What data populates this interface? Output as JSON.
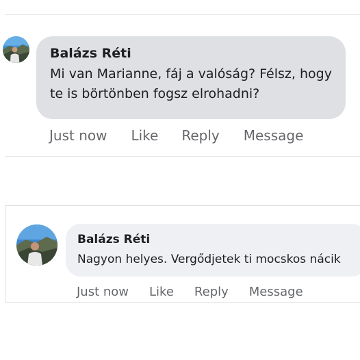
{
  "comments": [
    {
      "author": "Balázs Réti",
      "text": "Mi van Marianne, fáj a valóság? Félsz, hogy te is börtönben fogsz elrohadni?",
      "actions": {
        "time": "Just now",
        "like": "Like",
        "reply": "Reply",
        "message": "Message"
      }
    },
    {
      "author": "Balázs Réti",
      "text": "Nagyon helyes. Vergődjetek ti mocskos nácik",
      "actions": {
        "time": "Just now",
        "like": "Like",
        "reply": "Reply",
        "message": "Message"
      }
    }
  ]
}
